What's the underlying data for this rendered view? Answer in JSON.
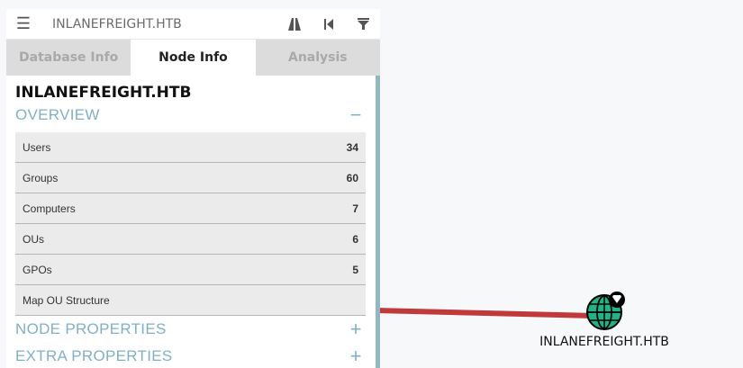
{
  "search": {
    "value": "INLANEFREIGHT.HTB"
  },
  "tabs": [
    "Database Info",
    "Node Info",
    "Analysis"
  ],
  "node_info": {
    "title": "INLANEFREIGHT.HTB",
    "overview": {
      "heading": "OVERVIEW",
      "toggle": "−",
      "rows": [
        {
          "label": "Users",
          "value": "34"
        },
        {
          "label": "Groups",
          "value": "60"
        },
        {
          "label": "Computers",
          "value": "7"
        },
        {
          "label": "OUs",
          "value": "6"
        },
        {
          "label": "GPOs",
          "value": "5"
        },
        {
          "label": "Map OU Structure",
          "value": ""
        }
      ]
    },
    "node_properties": {
      "heading": "NODE PROPERTIES",
      "toggle": "+"
    },
    "extra_properties": {
      "heading": "EXTRA PROPERTIES",
      "toggle": "+"
    }
  },
  "graph": {
    "node_label": "INLANEFREIGHT.HTB",
    "node_color": "#1fb487",
    "edge_color": "#c0393b"
  }
}
